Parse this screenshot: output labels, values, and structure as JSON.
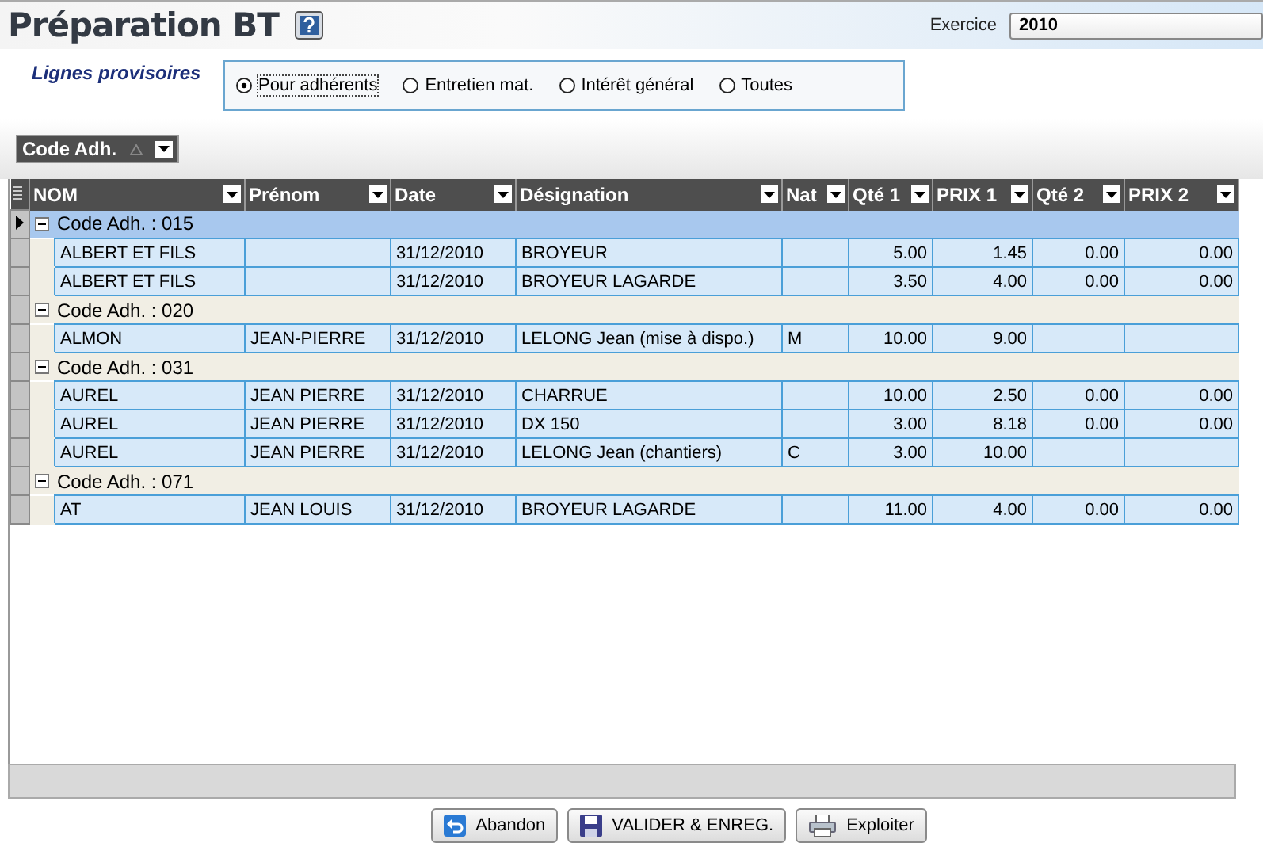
{
  "title": "Préparation BT",
  "exercice": {
    "label": "Exercice",
    "value": "2010"
  },
  "filter": {
    "label": "Lignes provisoires",
    "options": [
      {
        "label": "Pour adhérents",
        "selected": true
      },
      {
        "label": "Entretien mat.",
        "selected": false
      },
      {
        "label": "Intérêt général",
        "selected": false
      },
      {
        "label": "Toutes",
        "selected": false
      }
    ]
  },
  "group_by": {
    "label": "Code Adh."
  },
  "table": {
    "columns": [
      "NOM",
      "Prénom",
      "Date",
      "Désignation",
      "Nat",
      "Qté 1",
      "PRIX 1",
      "Qté 2",
      "PRIX 2"
    ],
    "groups": [
      {
        "label": "Code Adh. : 015",
        "expanded": true,
        "selected": true,
        "rows": [
          [
            "ALBERT ET FILS",
            "",
            "31/12/2010",
            "BROYEUR",
            "",
            "5.00",
            "1.45",
            "0.00",
            "0.00"
          ],
          [
            "ALBERT ET FILS",
            "",
            "31/12/2010",
            "BROYEUR LAGARDE",
            "",
            "3.50",
            "4.00",
            "0.00",
            "0.00"
          ]
        ]
      },
      {
        "label": "Code Adh. : 020",
        "expanded": true,
        "selected": false,
        "rows": [
          [
            "ALMON",
            "JEAN-PIERRE",
            "31/12/2010",
            "LELONG Jean (mise à dispo.)",
            "M",
            "10.00",
            "9.00",
            "",
            ""
          ]
        ]
      },
      {
        "label": "Code Adh. : 031",
        "expanded": true,
        "selected": false,
        "rows": [
          [
            "AUREL",
            "JEAN PIERRE",
            "31/12/2010",
            "CHARRUE",
            "",
            "10.00",
            "2.50",
            "0.00",
            "0.00"
          ],
          [
            "AUREL",
            "JEAN PIERRE",
            "31/12/2010",
            "DX 150",
            "",
            "3.00",
            "8.18",
            "0.00",
            "0.00"
          ],
          [
            "AUREL",
            "JEAN PIERRE",
            "31/12/2010",
            "LELONG Jean (chantiers)",
            "C",
            "3.00",
            "10.00",
            "",
            ""
          ]
        ]
      },
      {
        "label": "Code Adh. : 071",
        "expanded": true,
        "selected": false,
        "rows": [
          [
            "AT",
            "JEAN LOUIS",
            "31/12/2010",
            "BROYEUR LAGARDE",
            "",
            "11.00",
            "4.00",
            "0.00",
            "0.00"
          ]
        ]
      }
    ]
  },
  "buttons": [
    {
      "label": "Abandon",
      "kind": "undo"
    },
    {
      "label": "VALIDER & ENREG.",
      "kind": "save"
    },
    {
      "label": "Exploiter",
      "kind": "print"
    }
  ]
}
